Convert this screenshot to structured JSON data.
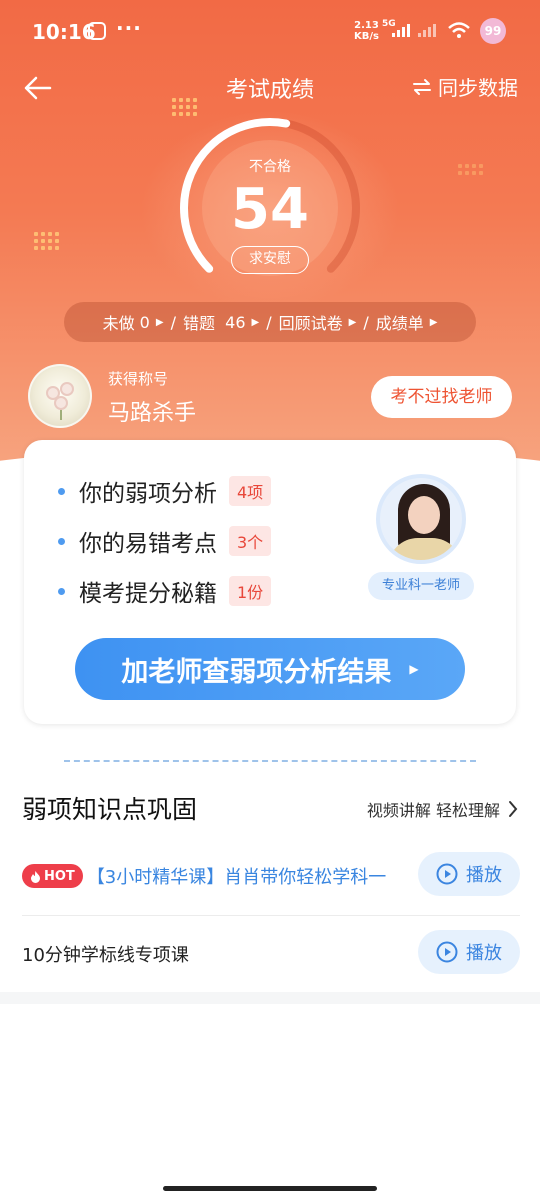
{
  "status_bar": {
    "time": "10:16",
    "more": "···",
    "net_speed": "2.13",
    "net_unit": "KB/s",
    "network": "5G",
    "battery": "99"
  },
  "header": {
    "title": "考试成绩",
    "sync_label": "同步数据"
  },
  "score": {
    "grade": "不合格",
    "value": "54",
    "comfort_label": "求安慰",
    "accent": "#ffffff"
  },
  "summary": {
    "undone_label": "未做",
    "undone_count": "0",
    "wrong_label": "错题",
    "wrong_count": "46",
    "review_label": "回顾试卷",
    "report_label": "成绩单",
    "separator": "/"
  },
  "user": {
    "caption": "获得称号",
    "title": "马路杀手",
    "ask_teacher_label": "考不过找老师"
  },
  "analysis_card": {
    "items": [
      {
        "label": "你的弱项分析",
        "count": "4项"
      },
      {
        "label": "你的易错考点",
        "count": "3个"
      },
      {
        "label": "模考提分秘籍",
        "count": "1份"
      }
    ],
    "teacher_tag": "专业科一老师",
    "cta_label": "加老师查弱项分析结果",
    "cta_color": "#3e92f2"
  },
  "weak_section": {
    "title": "弱项知识点巩固",
    "more_label": "视频讲解 轻松理解",
    "courses": [
      {
        "badge": "HOT",
        "title": "【3小时精华课】肖肖带你轻松学科一",
        "play_label": "播放"
      },
      {
        "title": "10分钟学标线专项课",
        "play_label": "播放"
      }
    ]
  },
  "colors": {
    "hero_top": "#f26a45",
    "hot_badge": "#ee3e4a",
    "link_blue": "#3a86e0"
  }
}
